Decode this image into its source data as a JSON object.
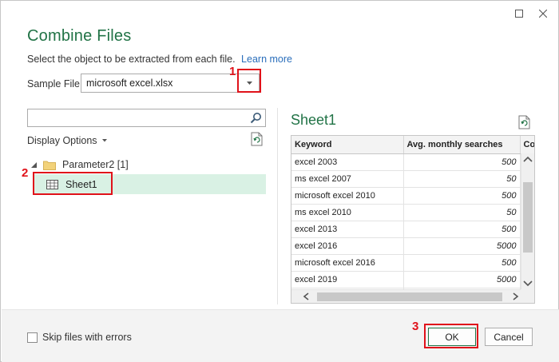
{
  "dialog": {
    "title": "Combine Files",
    "subtitle": "Select the object to be extracted from each file.",
    "learn_more": "Learn more"
  },
  "sample_file": {
    "label": "Sample File:",
    "value": "microsoft excel.xlsx"
  },
  "navigator": {
    "search_placeholder": "",
    "display_options": "Display Options",
    "tree": {
      "parent": "Parameter2 [1]",
      "child": "Sheet1"
    }
  },
  "preview": {
    "title": "Sheet1",
    "columns": [
      "Keyword",
      "Avg. monthly searches",
      "Co"
    ],
    "rows": [
      [
        "excel 2003",
        "500"
      ],
      [
        "ms excel 2007",
        "50"
      ],
      [
        "microsoft excel 2010",
        "500"
      ],
      [
        "ms excel 2010",
        "50"
      ],
      [
        "excel 2013",
        "500"
      ],
      [
        "excel 2016",
        "5000"
      ],
      [
        "microsoft excel 2016",
        "500"
      ],
      [
        "excel 2019",
        "5000"
      ],
      [
        "",
        ""
      ]
    ]
  },
  "footer": {
    "skip_label": "Skip files with errors",
    "skip_checked": false,
    "ok": "OK",
    "cancel": "Cancel"
  },
  "callouts": [
    "1",
    "2",
    "3"
  ],
  "colors": {
    "accent": "#217346",
    "highlight": "#d9f1e4",
    "callout": "#e0121a",
    "link": "#2a6ebb"
  }
}
